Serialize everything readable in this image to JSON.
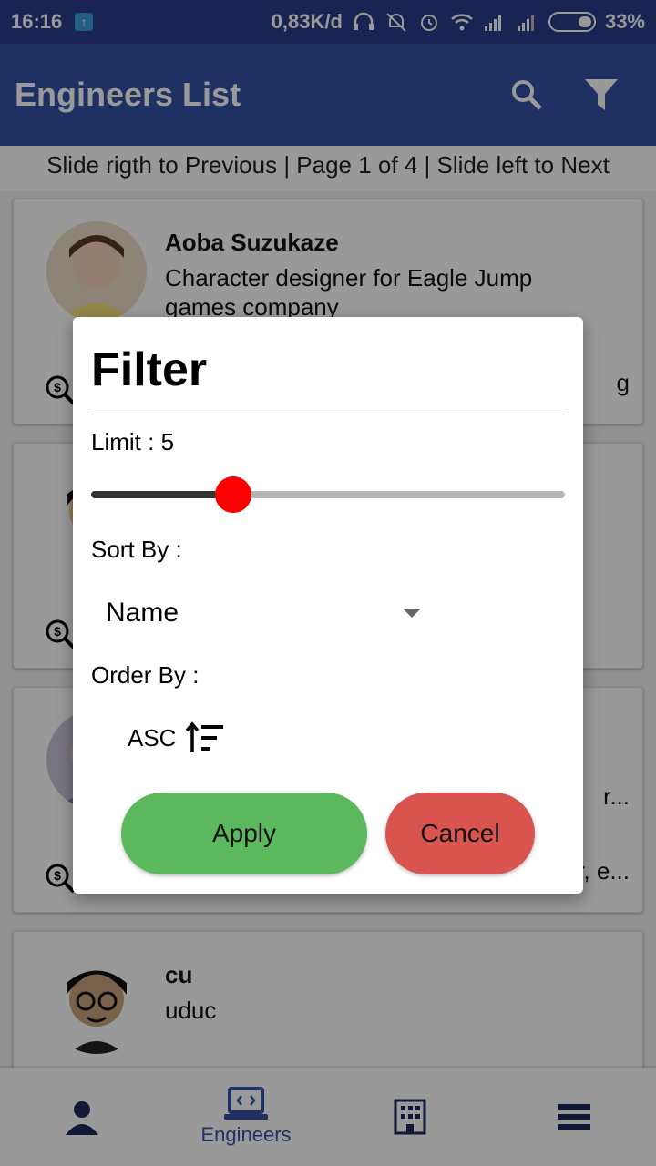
{
  "status_bar": {
    "time": "16:16",
    "speed": "0,83K/d",
    "battery": "33%",
    "icons": [
      "upload-icon",
      "headset-icon",
      "bell-off-icon",
      "alarm-icon",
      "wifi-icon",
      "signal-icon",
      "signal-icon",
      "battery-icon"
    ]
  },
  "app_bar": {
    "title": "Engineers List",
    "actions": [
      "search-icon",
      "filter-icon"
    ]
  },
  "pager": {
    "text": "Slide rigth to Previous | Page 1 of 4 | Slide left to Next"
  },
  "cards": [
    {
      "name": "Aoba Suzukaze",
      "description": "Character designer for Eagle Jump games company",
      "tail": "g"
    },
    {
      "name": "",
      "description": "",
      "tail": ""
    },
    {
      "name": "",
      "description": "",
      "tail_top": "r...",
      "tail": "r, e..."
    },
    {
      "name": "cu",
      "description": "uduc",
      "tail": ""
    }
  ],
  "bottom_nav": {
    "tabs": [
      {
        "icon": "person-icon",
        "label": ""
      },
      {
        "icon": "laptop-code-icon",
        "label": "Engineers"
      },
      {
        "icon": "building-icon",
        "label": ""
      },
      {
        "icon": "menu-icon",
        "label": ""
      }
    ],
    "active_index": 1
  },
  "dialog": {
    "title": "Filter",
    "limit_label": "Limit : 5",
    "limit_value": 5,
    "slider_fraction": 0.3,
    "sort_by_label": "Sort By :",
    "sort_by_value": "Name",
    "order_by_label": "Order By :",
    "order_value": "ASC",
    "apply_label": "Apply",
    "cancel_label": "Cancel",
    "colors": {
      "apply": "#5cb85c",
      "cancel": "#d9534f",
      "thumb": "#ff0000"
    }
  }
}
